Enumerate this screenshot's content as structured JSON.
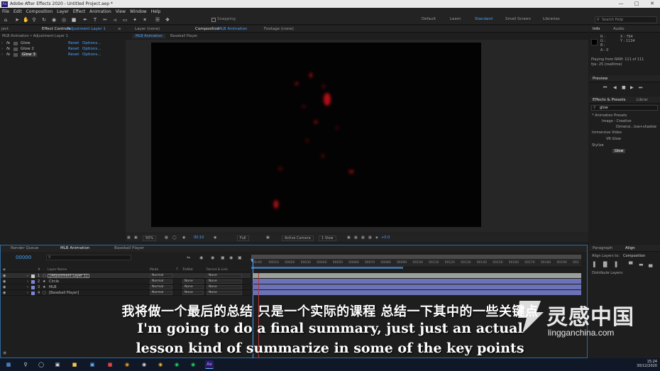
{
  "window": {
    "title": "Adobe After Effects 2020 - Untitled Project.aep *",
    "app_badge": "Ae"
  },
  "menu": [
    "File",
    "Edit",
    "Composition",
    "Layer",
    "Effect",
    "Animation",
    "View",
    "Window",
    "Help"
  ],
  "toolbar": {
    "snapping_label": "Snapping",
    "workspaces": [
      "Default",
      "Learn",
      "Standard",
      "Small Screen",
      "Libraries"
    ],
    "active_workspace": "Standard",
    "search_placeholder": "Search Help"
  },
  "effect_controls": {
    "tab_prefix": "ject",
    "tab_label": "Effect Controls",
    "tab_target": "Adjustment Layer 1",
    "breadcrumb": "MLB Animation • Adjustment Layer 1",
    "effects": [
      {
        "fx": "fx",
        "name": "Glow",
        "reset": "Reset",
        "options": "Options..."
      },
      {
        "fx": "fx",
        "name": "Glow 2",
        "reset": "Reset",
        "options": "Options..."
      },
      {
        "fx": "fx",
        "name": "Glow 3",
        "reset": "Reset",
        "options": "Options..."
      }
    ]
  },
  "viewer": {
    "layer_tab": "Layer (none)",
    "comp_tab_prefix": "Composition",
    "comp_tab_name": "MLB Animation",
    "footage_tab": "Footage (none)",
    "breadcrumbs": [
      "MLB Animation",
      "Baseball Player"
    ],
    "zoom": "50%",
    "timecode": "00:10",
    "resolution": "Full",
    "camera": "Active Camera",
    "views": "1 View",
    "exposure": "+0.0"
  },
  "info": {
    "tabs": [
      "Info",
      "Audio"
    ],
    "rgb": [
      "R :",
      "G :",
      "B :",
      "A : 0"
    ],
    "coords": [
      "X : 764",
      "Y : 1134"
    ],
    "playing_line1": "Playing from RAM: 111 of 111",
    "playing_line2": "fps: 25 (realtime)"
  },
  "preview": {
    "title": "Preview"
  },
  "effects_presets": {
    "tabs": [
      "Effects & Presets",
      "Librar"
    ],
    "search_value": "glow",
    "tree": [
      {
        "label": "* Animation Presets",
        "indent": 0
      },
      {
        "label": "Image - Creative",
        "indent": 1
      },
      {
        "label": "Dimensi...low+shadow",
        "indent": 2
      },
      {
        "label": "Immersive Video",
        "indent": 0
      },
      {
        "label": "VR Glow",
        "indent": 1
      },
      {
        "label": "Stylize",
        "indent": 0
      },
      {
        "label": "Glow",
        "indent": 1
      }
    ]
  },
  "align": {
    "tabs": [
      "Paragraph",
      "Align"
    ],
    "align_to_label": "Align Layers to:",
    "align_to_value": "Composition",
    "distribute_label": "Distribute Layers:"
  },
  "timeline": {
    "tabs": [
      "Render Queue",
      "MLB Animation",
      "Baseball Player"
    ],
    "timecode": "00000",
    "columns": [
      "#",
      "Layer Name",
      "Mode",
      "T",
      "TrkMat",
      "Parent & Link"
    ],
    "layers": [
      {
        "num": "1",
        "name": "[Adjustment Layer 1]",
        "mode": "Normal",
        "trkmat": "",
        "parent": "None",
        "color": "#c9c9c9",
        "selected": true
      },
      {
        "num": "2",
        "name": "Circle",
        "mode": "Normal",
        "trkmat": "None",
        "parent": "None",
        "color": "#7b86d4",
        "selected": false
      },
      {
        "num": "3",
        "name": "MLB",
        "mode": "Normal",
        "trkmat": "None",
        "parent": "None",
        "color": "#7b86d4",
        "selected": false
      },
      {
        "num": "4",
        "name": "[Baseball Player]",
        "mode": "Normal",
        "trkmat": "None",
        "parent": "None",
        "color": "#7b86d4",
        "selected": false
      }
    ],
    "ruler": [
      "00:00",
      "00010",
      "00020",
      "00030",
      "00040",
      "00050",
      "00060",
      "00070",
      "00080",
      "00090",
      "00100",
      "00110",
      "00120",
      "00130",
      "00140",
      "00150",
      "00160",
      "00170",
      "00180",
      "00190",
      "002"
    ],
    "work_area_fraction": 0.46
  },
  "subtitles": {
    "cn": "我将做一个最后的总结 只是一个实际的课程 总结一下其中的一些关键点",
    "en_line1": "I'm going to do a final summary, just just an actual",
    "en_line2": "lesson kind of summarize in some of the key points"
  },
  "watermark": {
    "cn": "灵感中国",
    "url": "lingganchina.com"
  },
  "taskbar": {
    "clock_time": "15:24",
    "clock_date": "30/12/2020"
  },
  "colors": {
    "accent": "#4aa3ff",
    "timeline_border": "#2d6aa0",
    "layer_bar": "#6c72b8",
    "adjustment_bar": "#9aa09a",
    "glow_red": "#d0121a"
  }
}
